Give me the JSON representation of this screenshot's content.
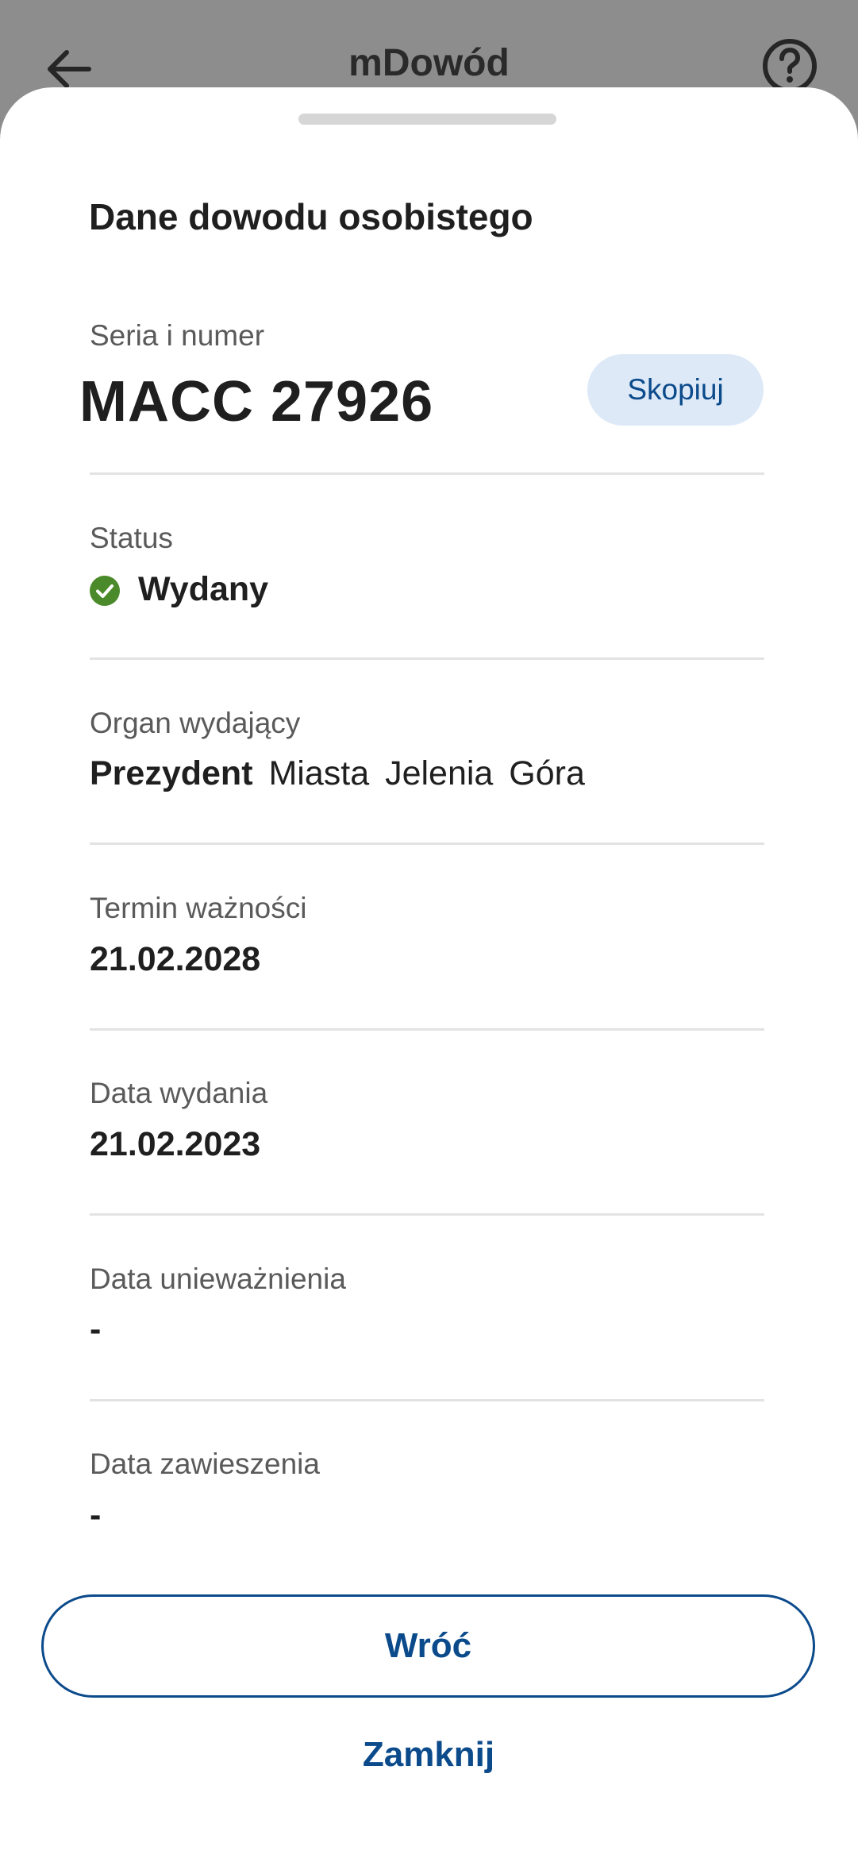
{
  "app_bar": {
    "title": "mDowód",
    "back_icon": "arrow-left-icon",
    "help_icon": "question-circle-icon"
  },
  "sheet": {
    "title": "Dane dowodu osobistego",
    "fields": {
      "number": {
        "label": "Seria i numer",
        "value": "MACC 27926",
        "copy_label": "Skopiuj"
      },
      "status": {
        "label": "Status",
        "value": "Wydany",
        "icon": "check-circle-icon",
        "color": "#4a8a2a"
      },
      "issuer": {
        "label": "Organ wydający",
        "value_bold": "Prezydent",
        "value_rest": "Miasta Jelenia Góra"
      },
      "expiry": {
        "label": "Termin ważności",
        "value": "21.02.2028"
      },
      "issue_date": {
        "label": "Data wydania",
        "value": "21.02.2023"
      },
      "invalidation_date": {
        "label": "Data unieważnienia",
        "value": "-"
      },
      "suspension_date": {
        "label": "Data zawieszenia",
        "value": "-"
      }
    },
    "buttons": {
      "back": "Wróć",
      "close": "Zamknij"
    }
  },
  "colors": {
    "accent": "#0b4a8b",
    "copy_button_bg": "#dde9f7",
    "overlay": "#8d8d8d",
    "divider": "#e3e3e3"
  }
}
